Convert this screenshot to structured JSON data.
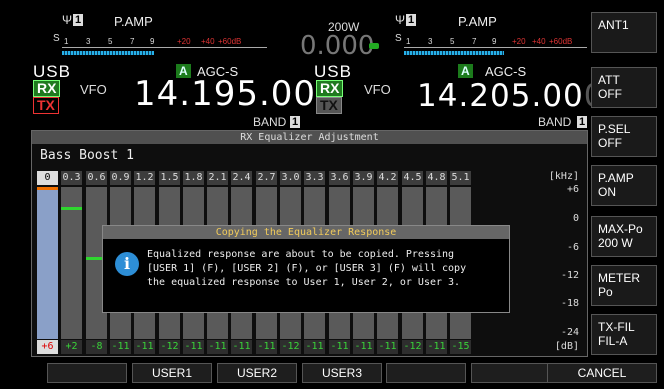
{
  "main": {
    "ant_symbol": "Ψ",
    "ant_num": "1",
    "pamp": "P.AMP",
    "s_label": "S",
    "s_ticks": [
      "1",
      "3",
      "5",
      "7",
      "9"
    ],
    "s_ticks_red": [
      "+20",
      "+40",
      "+60dB"
    ],
    "mode": "USB",
    "rx": "RX",
    "tx": "TX",
    "vfo": "VFO",
    "agc_a": "A",
    "agc": "AGC-S",
    "freq_main": "14.195.00",
    "freq_dim": "0",
    "band": "BAND",
    "band_num": "1"
  },
  "center": {
    "power": "200W",
    "value": "0.000"
  },
  "sub": {
    "ant_symbol": "Ψ",
    "ant_num": "1",
    "pamp": "P.AMP",
    "s_label": "S",
    "s_ticks": [
      "1",
      "3",
      "5",
      "7",
      "9"
    ],
    "s_ticks_red": [
      "+20",
      "+40",
      "+60dB"
    ],
    "mode": "USB",
    "rx": "RX",
    "tx": "TX",
    "vfo": "VFO",
    "agc_a": "A",
    "agc": "AGC-S",
    "freq_main": "14.205.00",
    "freq_dim": "0",
    "band": "BAND",
    "band_num": "1"
  },
  "right_buttons": [
    {
      "line1": "ANT1",
      "line2": ""
    },
    {
      "line1": "ATT",
      "line2": "OFF"
    },
    {
      "line1": "P.SEL",
      "line2": "OFF"
    },
    {
      "line1": "P.AMP",
      "line2": "ON"
    },
    {
      "line1": "MAX-Po",
      "line2": "200 W"
    },
    {
      "line1": "METER",
      "line2": "Po"
    },
    {
      "line1": "TX-FIL",
      "line2": "FIL-A"
    }
  ],
  "equalizer": {
    "title": "RX Equalizer Adjustment",
    "preset": "Bass Boost 1",
    "freqs": [
      "0",
      "0.3",
      "0.6",
      "0.9",
      "1.2",
      "1.5",
      "1.8",
      "2.1",
      "2.4",
      "2.7",
      "3.0",
      "3.3",
      "3.6",
      "3.9",
      "4.2",
      "4.5",
      "4.8",
      "5.1"
    ],
    "db": [
      "+6",
      "+2",
      "-8",
      "-11",
      "-11",
      "-12",
      "-11",
      "-11",
      "-11",
      "-11",
      "-12",
      "-11",
      "-11",
      "-11",
      "-11",
      "-12",
      "-11",
      "-15"
    ],
    "selected_index": 0,
    "khz_label": "[kHz]",
    "db_label": "[dB]",
    "y_ticks": [
      "+6",
      "0",
      "-6",
      "-12",
      "-18",
      "-24"
    ],
    "level_color": "#2fd62f",
    "selected_color": "#f07000"
  },
  "dialog": {
    "title": "Copying the Equalizer Response",
    "icon": "info-icon",
    "line1": "Equalized response are about to be copied. Pressing",
    "line2": "[USER 1] (F), [USER 2] (F), or [USER 3] (F) will copy",
    "line3": "the equalized response to User 1, User 2, or User 3."
  },
  "fkeys": [
    "",
    "USER1",
    "USER2",
    "USER3",
    "",
    "",
    "CANCEL"
  ]
}
